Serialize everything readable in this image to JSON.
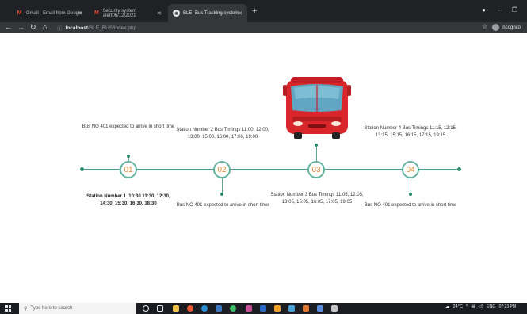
{
  "browser": {
    "tabs": [
      {
        "label": "Gmail - Email from Google",
        "active": false
      },
      {
        "label": "Security system alert06/12/2021",
        "active": false
      },
      {
        "label": "BLE- Bus Tracking system",
        "active": true
      }
    ],
    "new_tab": "+",
    "url_host": "localhost",
    "url_path": "/BLE_BUS/index.php",
    "profile_label": "Incognito",
    "minimize": "–",
    "restore": "❐"
  },
  "timeline": {
    "nodes": [
      "01",
      "02",
      "03",
      "04"
    ],
    "texts": {
      "n1_top": "Bus NO 401 expected to arrive in short time",
      "n1_bottom": "Station Number 1 ,10:30 11:30, 12:30, 14:30, 15:30, 16:30, 18:30",
      "n2_top": "Station Number 2 Bus Timings 11:00, 12:00, 13:00, 15:00, 16:00, 17:00, 19:00",
      "n2_bottom": "Bus NO 401 expected to arrive in short time",
      "n3_bottom": "Station Number 3 Bus Timings 11:05, 12:05, 13:05, 15:05, 16:05, 17:05, 19:05",
      "n4_top": "Station Number 4 Bus Timings 11:15, 12:15, 13:15, 15:15, 16:15, 17:15, 19:15",
      "n4_bottom": "Bus NO 401 expected to arrive in short time"
    }
  },
  "taskbar": {
    "search_placeholder": "Type here to search",
    "weather": "24°C",
    "lang": "ENG",
    "time": "07:23 PM"
  },
  "colors": {
    "timeline": "#4a9f8e",
    "node_text": "#e08a3c",
    "bus_red": "#d9262b"
  }
}
